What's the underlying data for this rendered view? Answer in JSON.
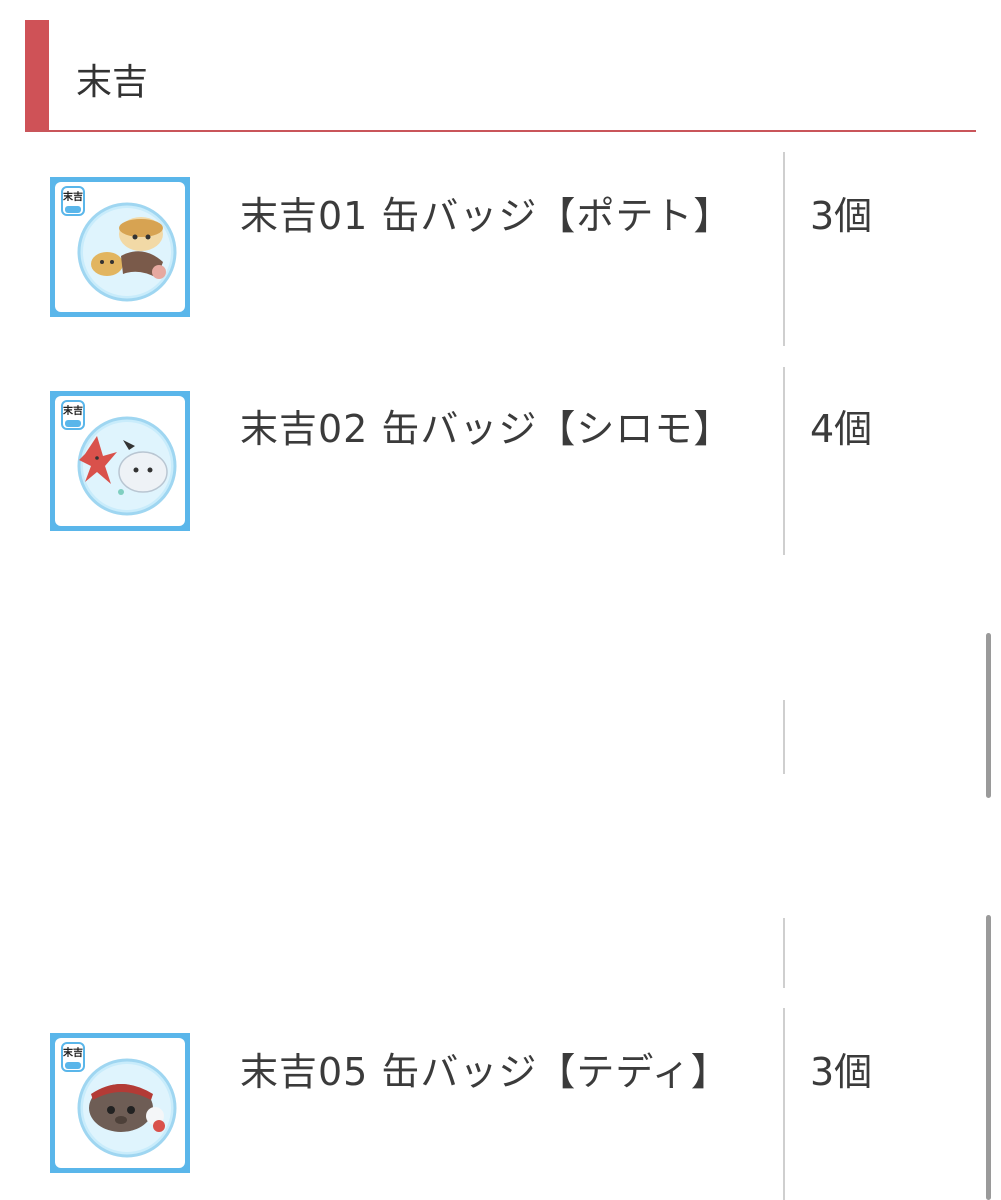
{
  "section": {
    "title": "末吉",
    "accent_color": "#cf5257"
  },
  "items": [
    {
      "badge_text": "末吉",
      "name": "末吉01 缶バッジ【ポテト】",
      "quantity": "3個",
      "icon": "potato-guinea-pig-badge"
    },
    {
      "badge_text": "末吉",
      "name": "末吉02 缶バッジ【シロモ】",
      "quantity": "4個",
      "icon": "shiromo-guinea-pig-badge"
    },
    {
      "badge_text": "末吉",
      "name": "末吉05 缶バッジ【テディ】",
      "quantity": "3個",
      "icon": "teddy-guinea-pig-badge"
    }
  ]
}
